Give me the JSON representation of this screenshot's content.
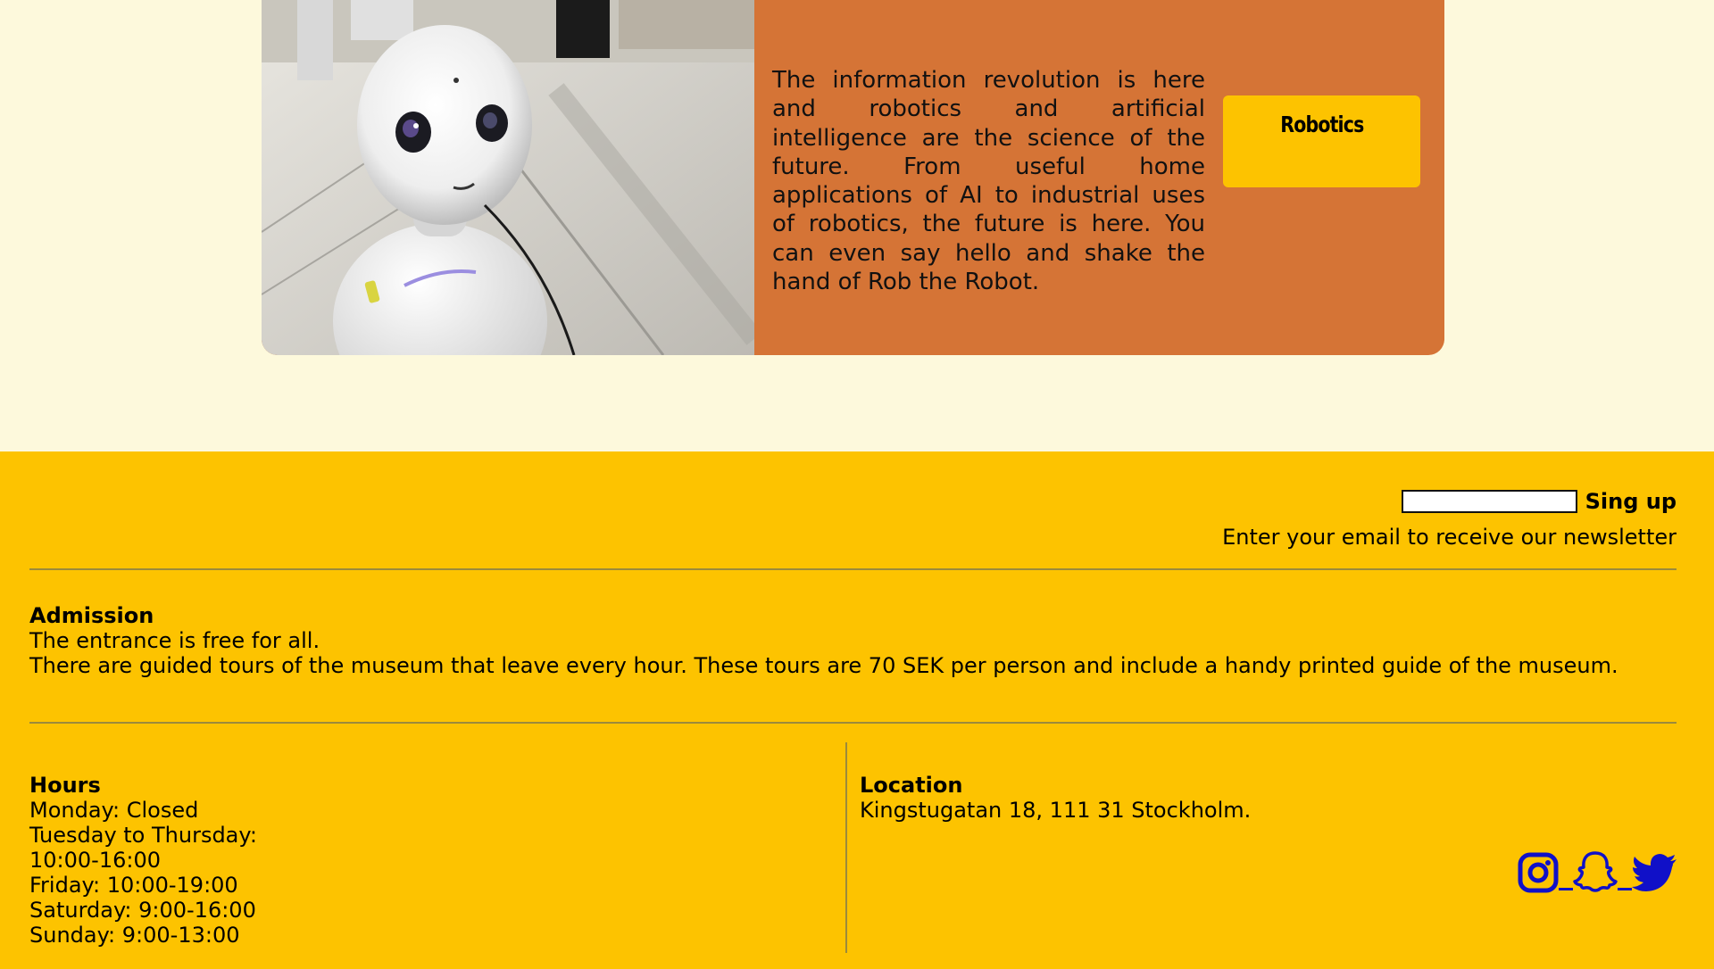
{
  "card": {
    "description": "The information revolution is here and robotics and artificial intelligence are the science of the future. From useful home applications of AI to industrial uses of robotics, the future is here. You can even say hello and shake the hand of Rob the Robot.",
    "button_label": "Robotics",
    "image_subject": "white humanoid robot in a hall"
  },
  "newsletter": {
    "email_value": "",
    "email_placeholder": "",
    "signup_label": "Sing up",
    "note": "Enter your email to receive our newsletter"
  },
  "admission": {
    "heading": "Admission",
    "line1": "The entrance is free for all.",
    "line2": "There are guided tours of the museum that leave every hour. These tours are 70 SEK per person and include a handy printed guide of the museum."
  },
  "hours": {
    "heading": "Hours",
    "lines": [
      "Monday: Closed",
      "Tuesday to Thursday:",
      "10:00-16:00",
      "Friday: 10:00-19:00",
      "Saturday: 9:00-16:00",
      "Sunday: 9:00-13:00"
    ]
  },
  "location": {
    "heading": "Location",
    "address": "Kingstugatan 18, 111 31 Stockholm."
  },
  "social": {
    "icons": [
      "instagram-icon",
      "snapchat-icon",
      "twitter-icon"
    ],
    "color": "#1010c8"
  },
  "colors": {
    "page_bg": "#fdf9dc",
    "card_bg": "#d57436",
    "accent": "#fdc300",
    "divider": "#9b8a3c"
  }
}
